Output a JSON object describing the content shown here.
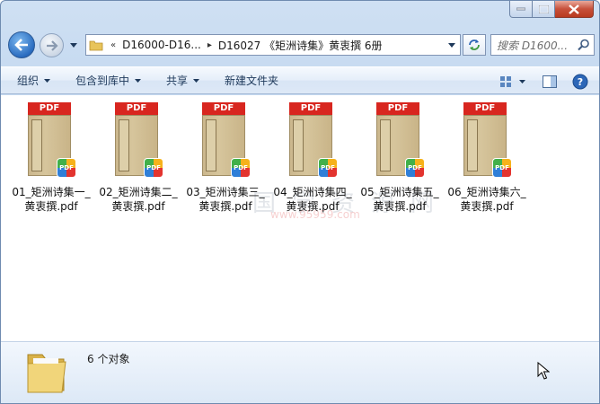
{
  "window": {
    "caption_buttons": [
      "minimize",
      "maximize",
      "close"
    ]
  },
  "address_bar": {
    "overflow_chevron": "«",
    "segments": [
      "D16000-D16...",
      "D16027 《矩洲诗集》黄衷撰 6册"
    ],
    "separator": "▸"
  },
  "search": {
    "placeholder": "搜索 D1600..."
  },
  "toolbar": {
    "organize": "组织",
    "include_in_library": "包含到库中",
    "share": "共享",
    "new_folder": "新建文件夹"
  },
  "files": [
    {
      "name": "01_矩洲诗集一_黄衷撰.pdf",
      "badge": "PDF"
    },
    {
      "name": "02_矩洲诗集二_黄衷撰.pdf",
      "badge": "PDF"
    },
    {
      "name": "03_矩洲诗集三_黄衷撰.pdf",
      "badge": "PDF"
    },
    {
      "name": "04_矩洲诗集四_黄衷撰.pdf",
      "badge": "PDF"
    },
    {
      "name": "05_矩洲诗集五_黄衷撰.pdf",
      "badge": "PDF"
    },
    {
      "name": "06_矩洲诗集六_黄衷撰.pdf",
      "badge": "PDF"
    }
  ],
  "cover_title": "矩洲詩集",
  "watermark": {
    "text": "国学资源网",
    "url": "www.95959.com"
  },
  "details_pane": {
    "count_text": "6 个对象"
  },
  "colors": {
    "toolbar_text": "#1e395b",
    "pdf_band": "#d8261f",
    "close_button": "#c7503a"
  }
}
